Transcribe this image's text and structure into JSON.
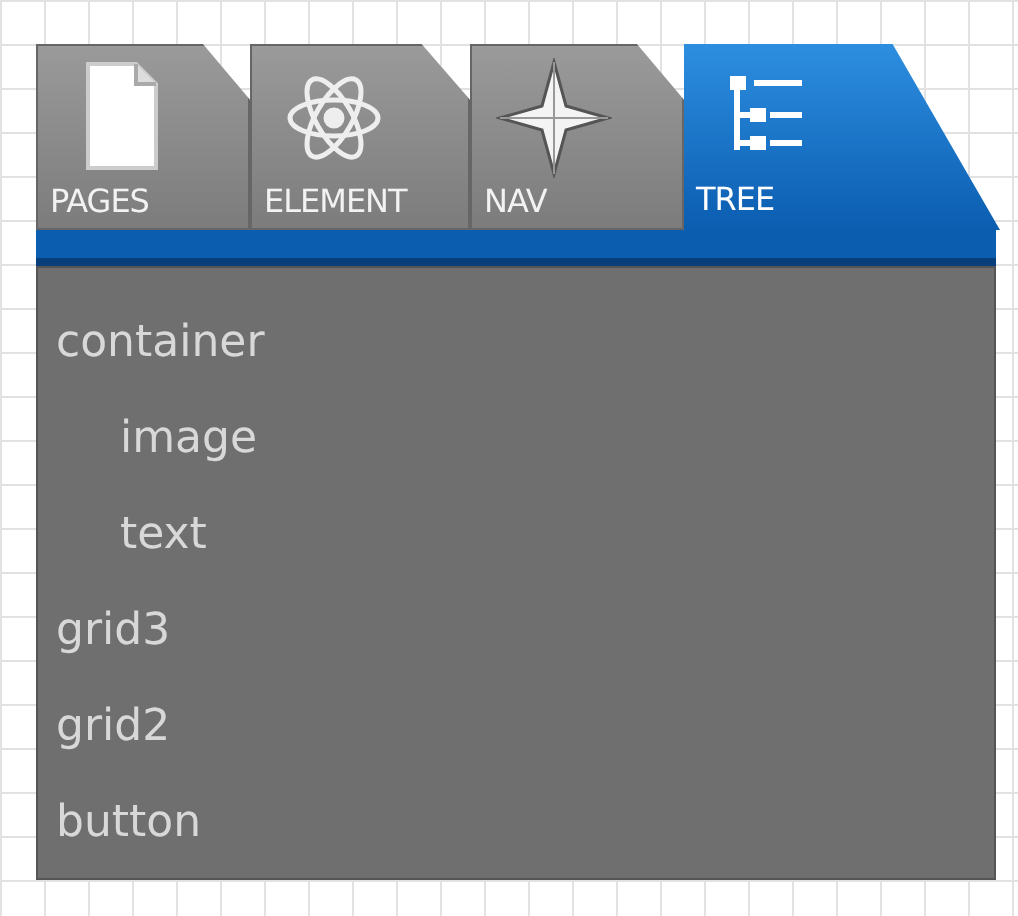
{
  "tabs": [
    {
      "label": "PAGES",
      "kind": "page",
      "selected": false
    },
    {
      "label": "ELEMENT",
      "kind": "atom",
      "selected": false
    },
    {
      "label": "NAV",
      "kind": "star",
      "selected": false
    },
    {
      "label": "TREE",
      "kind": "tree",
      "selected": true
    }
  ],
  "tree": [
    {
      "label": "container",
      "children": [
        {
          "label": "image"
        },
        {
          "label": "text"
        }
      ]
    },
    {
      "label": "grid3"
    },
    {
      "label": "grid2"
    },
    {
      "label": "button"
    }
  ]
}
